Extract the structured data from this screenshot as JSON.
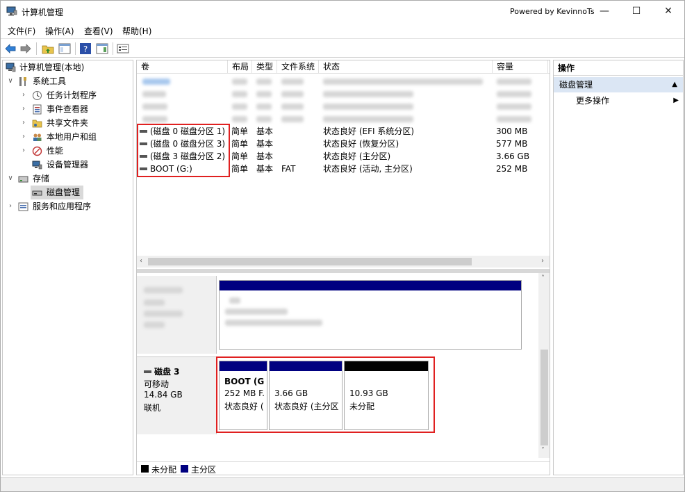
{
  "window": {
    "title": "计算机管理",
    "powered_by": "Powered by KevinnoTs",
    "minimize": "—",
    "maximize": "☐",
    "close": "✕"
  },
  "menu": [
    "文件(F)",
    "操作(A)",
    "查看(V)",
    "帮助(H)"
  ],
  "tree": {
    "root": "计算机管理(本地)",
    "system_tools": "系统工具",
    "task_scheduler": "任务计划程序",
    "event_viewer": "事件查看器",
    "shared_folders": "共享文件夹",
    "local_users": "本地用户和组",
    "performance": "性能",
    "device_manager": "设备管理器",
    "storage": "存储",
    "disk_management": "磁盘管理",
    "services": "服务和应用程序"
  },
  "volume_columns": [
    "卷",
    "布局",
    "类型",
    "文件系统",
    "状态",
    "容量"
  ],
  "volumes": [
    {
      "name": "(磁盘 0 磁盘分区 1)",
      "layout": "简单",
      "type": "基本",
      "fs": "",
      "status": "状态良好 (EFI 系统分区)",
      "capacity": "300 MB"
    },
    {
      "name": "(磁盘 0 磁盘分区 3)",
      "layout": "简单",
      "type": "基本",
      "fs": "",
      "status": "状态良好 (恢复分区)",
      "capacity": "577 MB"
    },
    {
      "name": "(磁盘 3 磁盘分区 2)",
      "layout": "简单",
      "type": "基本",
      "fs": "",
      "status": "状态良好 (主分区)",
      "capacity": "3.66 GB"
    },
    {
      "name": "BOOT (G:)",
      "layout": "简单",
      "type": "基本",
      "fs": "FAT",
      "status": "状态良好 (活动, 主分区)",
      "capacity": "252 MB"
    }
  ],
  "disk3": {
    "name": "磁盘 3",
    "kind": "可移动",
    "size": "14.84 GB",
    "state": "联机",
    "partitions": [
      {
        "title": "BOOT  (G",
        "size": "252 MB F.",
        "status": "状态良好 (",
        "bar_color": "#000080"
      },
      {
        "title": "",
        "size": "3.66 GB",
        "status": "状态良好 (主分区",
        "bar_color": "#000080"
      },
      {
        "title": "",
        "size": "10.93 GB",
        "status": "未分配",
        "bar_color": "#000000"
      }
    ]
  },
  "legend": [
    {
      "label": "未分配",
      "color": "#000000"
    },
    {
      "label": "主分区",
      "color": "#000080"
    }
  ],
  "actions": {
    "title": "操作",
    "section": "磁盘管理",
    "more": "更多操作"
  },
  "colors": {
    "highlight_box": "#e02020",
    "primary_partition": "#000080",
    "unallocated": "#000000"
  }
}
